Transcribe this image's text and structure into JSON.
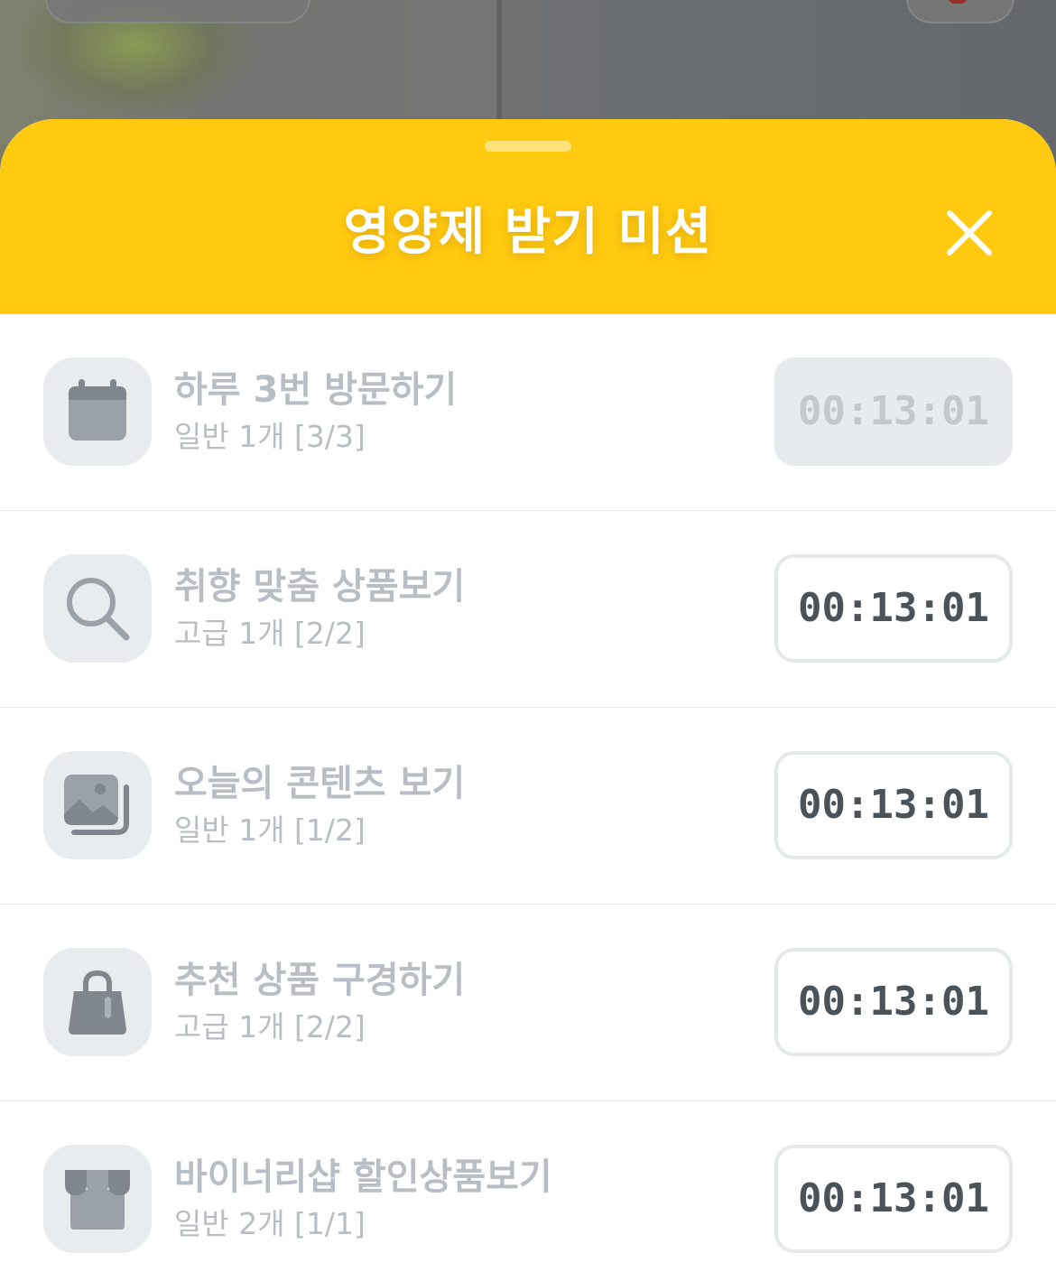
{
  "sheet": {
    "title": "영양제 받기 미션",
    "close_icon": "close-icon"
  },
  "colors": {
    "header_yellow": "#ffca10",
    "icon_bg": "#e9ecef",
    "muted_text": "#b9bec4",
    "timer_text": "#4b5258"
  },
  "missions": [
    {
      "title": "하루 3번 방문하기",
      "sub": "일반 1개 [3/3]",
      "timer": "00:13:01",
      "icon": "calendar-icon",
      "completed": true
    },
    {
      "title": "취향 맞춤 상품보기",
      "sub": "고급 1개 [2/2]",
      "timer": "00:13:01",
      "icon": "search-icon",
      "completed": false
    },
    {
      "title": "오늘의 콘텐츠 보기",
      "sub": "일반 1개 [1/2]",
      "timer": "00:13:01",
      "icon": "image-gallery-icon",
      "completed": false
    },
    {
      "title": "추천 상품 구경하기",
      "sub": "고급 1개 [2/2]",
      "timer": "00:13:01",
      "icon": "shopping-bag-icon",
      "completed": false
    },
    {
      "title": "바이너리샵 할인상품보기",
      "sub": "일반 2개 [1/1]",
      "timer": "00:13:01",
      "icon": "storefront-icon",
      "completed": false
    }
  ]
}
